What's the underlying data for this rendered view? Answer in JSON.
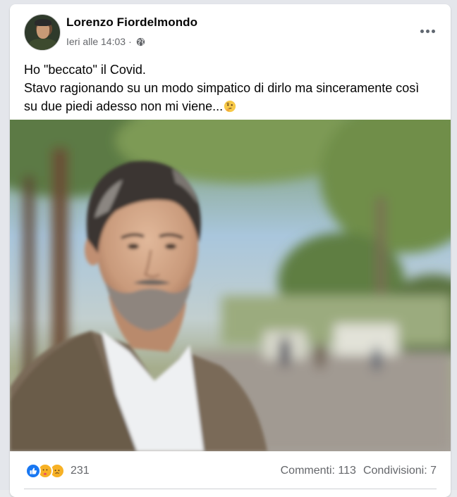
{
  "post": {
    "author": "Lorenzo Fiordelmondo",
    "timestamp": "Ieri alle 14:03",
    "separator": "·",
    "audience_icon": "globe-icon",
    "more_icon": "more-options-icon",
    "text_lines": [
      "Ho \"beccato\" il Covid.",
      "Stavo ragionando su un modo simpatico di dirlo ma sinceramente così",
      "su due piedi adesso non mi viene..."
    ],
    "trailing_emoji": "thinking-face-emoji",
    "photo_icon": "portrait-photo"
  },
  "stats": {
    "reaction_icons": [
      "like-icon",
      "care-icon",
      "sad-icon"
    ],
    "reaction_count": "231",
    "comments": "Commenti: 113",
    "shares": "Condivisioni: 7"
  },
  "colors": {
    "brand_blue": "#1877f2",
    "text_primary": "#050505",
    "text_secondary": "#65676b",
    "reaction_yellow": "#f7b125"
  }
}
